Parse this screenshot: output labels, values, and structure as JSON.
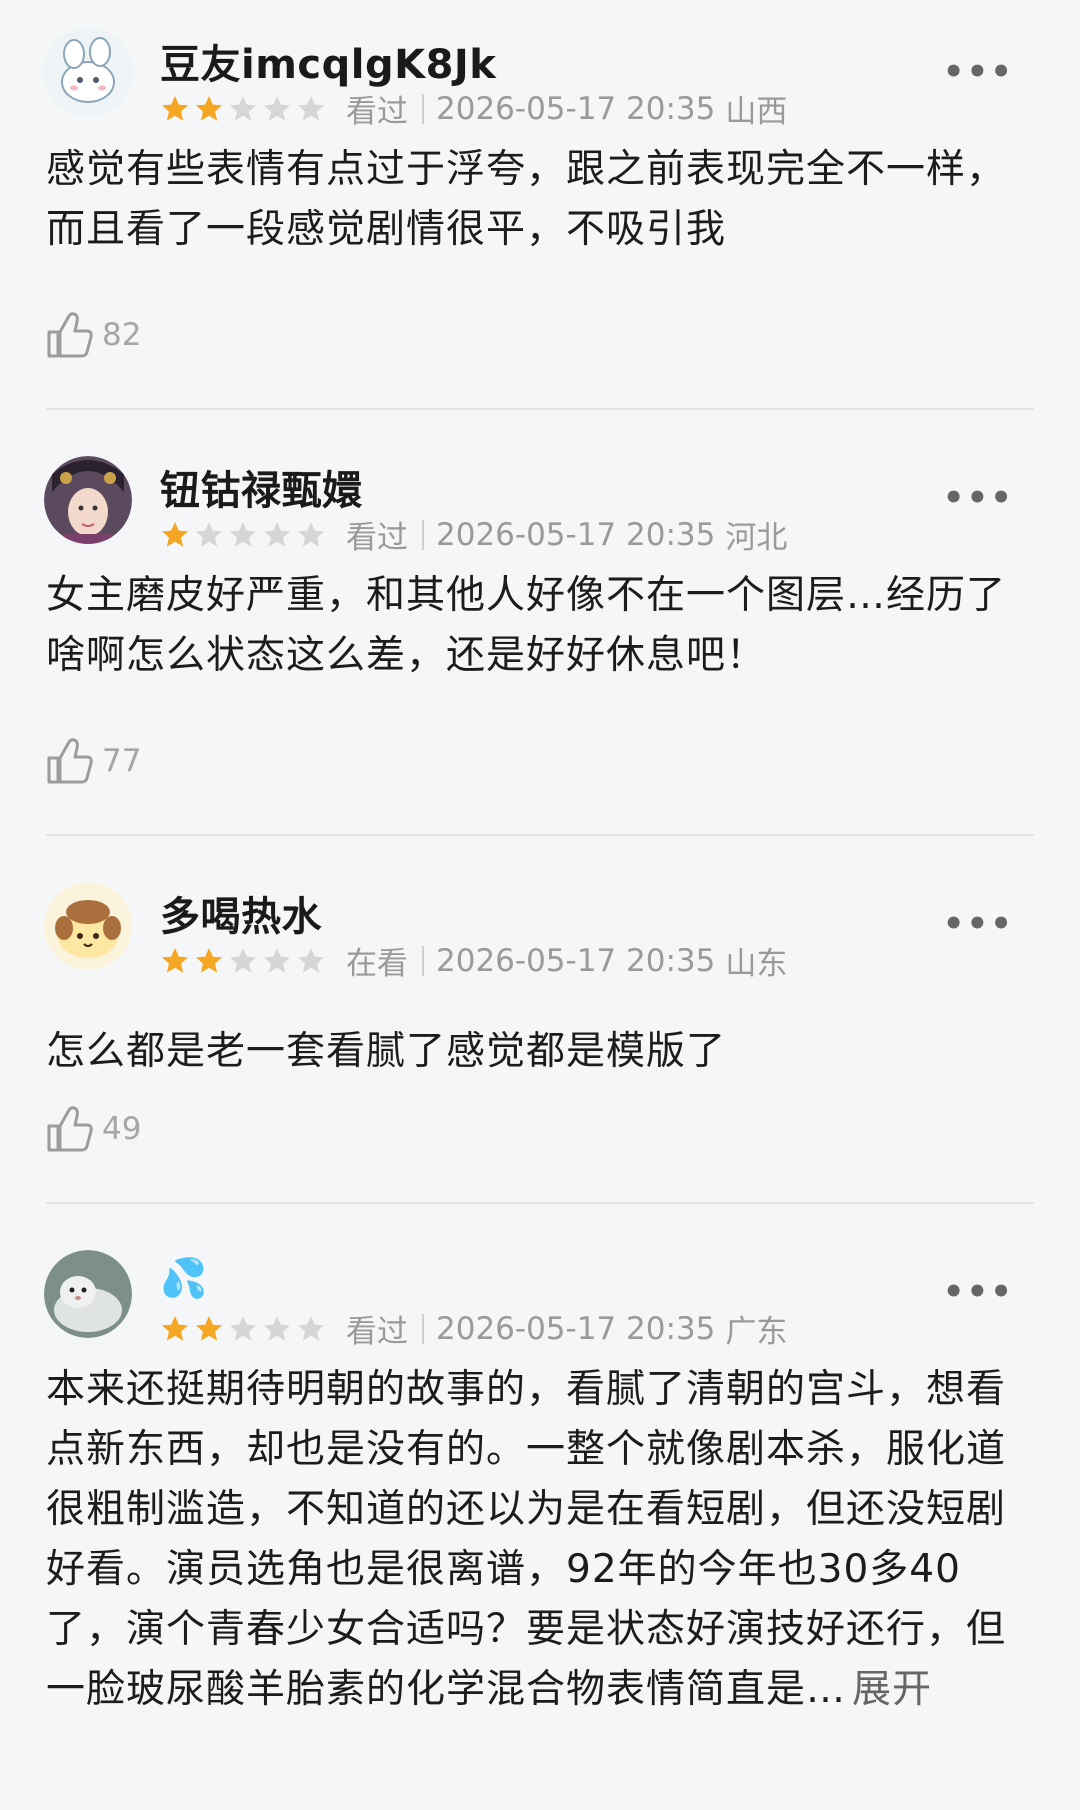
{
  "colors": {
    "star_on": "#f5a623",
    "star_off": "#d6d6d6",
    "background": "#f4f6f8"
  },
  "reviews": [
    {
      "username": "豆友imcqlgK8Jk",
      "rating": 2,
      "status": "看过",
      "datetime": "2026-05-17 20:35",
      "location": "山西",
      "content": "感觉有些表情有点过于浮夸，跟之前表现完全不一样，而且看了一段感觉剧情很平，不吸引我",
      "likes": "82",
      "more_icon": "more-dots-icon",
      "like_icon": "thumbs-up-icon"
    },
    {
      "username": "钮钴禄甄嬛",
      "rating": 1,
      "status": "看过",
      "datetime": "2026-05-17 20:35",
      "location": "河北",
      "content": "女主磨皮好严重，和其他人好像不在一个图层…经历了啥啊怎么状态这么差，还是好好休息吧！",
      "likes": "77",
      "more_icon": "more-dots-icon",
      "like_icon": "thumbs-up-icon"
    },
    {
      "username": "多喝热水",
      "rating": 2,
      "status": "在看",
      "datetime": "2026-05-17 20:35",
      "location": "山东",
      "content": "怎么都是老一套看腻了感觉都是模版了",
      "likes": "49",
      "more_icon": "more-dots-icon",
      "like_icon": "thumbs-up-icon"
    },
    {
      "username": "💦",
      "rating": 2,
      "status": "看过",
      "datetime": "2026-05-17 20:35",
      "location": "广东",
      "content": "本来还挺期待明朝的故事的，看腻了清朝的宫斗，想看点新东西，却也是没有的。一整个就像剧本杀，服化道很粗制滥造，不知道的还以为是在看短剧，但还没短剧好看。演员选角也是很离谱，92年的今年也30多40了，演个青春少女合适吗？要是状态好演技好还行，但一脸玻尿酸羊胎素的化学混合物表情简直是…",
      "expand_label": "展开",
      "more_icon": "more-dots-icon"
    }
  ],
  "more_label": "•••"
}
